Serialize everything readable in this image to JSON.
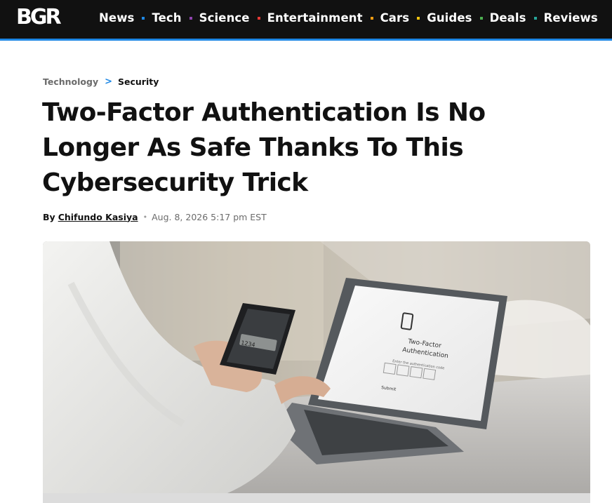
{
  "site": {
    "logo_text": "BGR"
  },
  "nav": {
    "items": [
      {
        "label": "News",
        "dot_color": "#1e88e5"
      },
      {
        "label": "Tech",
        "dot_color": "#8e44ad"
      },
      {
        "label": "Science",
        "dot_color": "#e53935"
      },
      {
        "label": "Entertainment",
        "dot_color": "#f39c12"
      },
      {
        "label": "Cars",
        "dot_color": "#f1c40f"
      },
      {
        "label": "Guides",
        "dot_color": "#4caf50"
      },
      {
        "label": "Deals",
        "dot_color": "#26a69a"
      },
      {
        "label": "Reviews",
        "dot_color": ""
      }
    ],
    "accent_color": "#1e88e5"
  },
  "breadcrumb": {
    "parent": "Technology",
    "separator": ">",
    "current": "Security"
  },
  "article": {
    "headline": "Two-Factor Authentication Is No Longer As Safe Thanks To This Cybersecurity Trick",
    "byline_prefix": "By",
    "author": "Chifundo Kasiya",
    "byline_separator": "•",
    "date": "Aug. 8, 2026 5:17 pm EST"
  },
  "hero_image": {
    "screen_title": "Two-Factor Authentication",
    "screen_subtitle": "Enter the authentication code",
    "screen_button": "Submit",
    "phone_code": "1234"
  }
}
